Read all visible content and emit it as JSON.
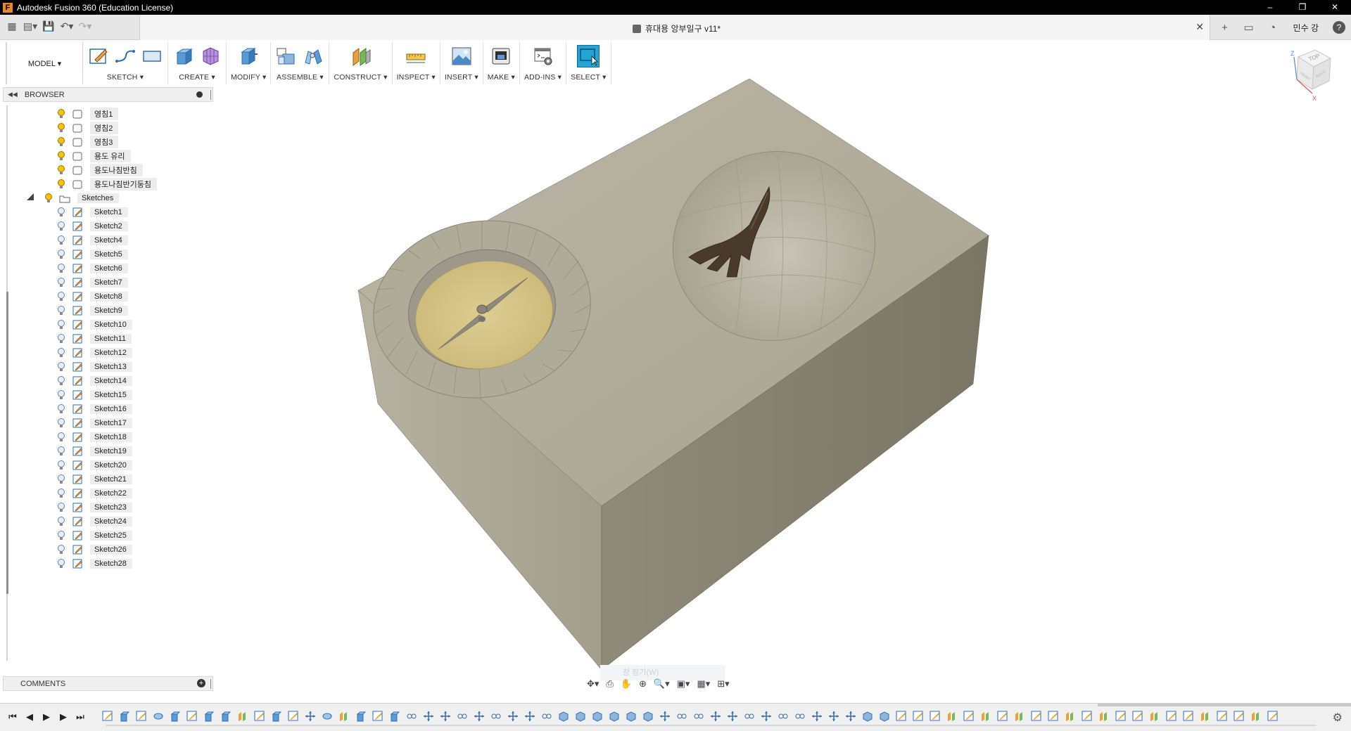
{
  "window": {
    "app_title": "Autodesk Fusion 360 (Education License)",
    "min": "–",
    "restore": "❐",
    "close": "✕"
  },
  "tabbar": {
    "doc_title": "휴대용 앙부일구 v11*",
    "close": "✕",
    "user": "민수 강",
    "help": "?"
  },
  "ribbon": {
    "workspace": "MODEL ▾",
    "groups": [
      {
        "label": "SKETCH ▾"
      },
      {
        "label": "CREATE ▾"
      },
      {
        "label": "MODIFY ▾"
      },
      {
        "label": "ASSEMBLE ▾"
      },
      {
        "label": "CONSTRUCT ▾"
      },
      {
        "label": "INSPECT ▾"
      },
      {
        "label": "INSERT ▾"
      },
      {
        "label": "MAKE ▾"
      },
      {
        "label": "ADD-INS ▾"
      },
      {
        "label": "SELECT ▾"
      }
    ]
  },
  "browser": {
    "title": "BROWSER",
    "bodies": [
      {
        "label": "영침1"
      },
      {
        "label": "영침2"
      },
      {
        "label": "영침3"
      },
      {
        "label": "용도 유리"
      },
      {
        "label": "용도나침반침"
      },
      {
        "label": "용도나침반기둥침"
      }
    ],
    "sketches_folder": "Sketches",
    "sketches": [
      {
        "label": "Sketch1"
      },
      {
        "label": "Sketch2"
      },
      {
        "label": "Sketch4"
      },
      {
        "label": "Sketch5"
      },
      {
        "label": "Sketch6"
      },
      {
        "label": "Sketch7"
      },
      {
        "label": "Sketch8"
      },
      {
        "label": "Sketch9"
      },
      {
        "label": "Sketch10"
      },
      {
        "label": "Sketch11"
      },
      {
        "label": "Sketch12"
      },
      {
        "label": "Sketch13"
      },
      {
        "label": "Sketch14"
      },
      {
        "label": "Sketch15"
      },
      {
        "label": "Sketch16"
      },
      {
        "label": "Sketch17"
      },
      {
        "label": "Sketch18"
      },
      {
        "label": "Sketch19"
      },
      {
        "label": "Sketch20"
      },
      {
        "label": "Sketch21"
      },
      {
        "label": "Sketch22"
      },
      {
        "label": "Sketch23"
      },
      {
        "label": "Sketch24"
      },
      {
        "label": "Sketch25"
      },
      {
        "label": "Sketch26"
      },
      {
        "label": "Sketch28"
      }
    ]
  },
  "comments": {
    "title": "COMMENTS",
    "add": "+"
  },
  "viewcube": {
    "top": "TOP",
    "front": "FRONT",
    "right": "RIGHT",
    "axis_z": "Z",
    "axis_x": "X"
  },
  "canvas": {
    "ghost_tip": "창 참기(W)"
  },
  "colors": {
    "select_accent": "#1ea7d6",
    "body_top": "#b8b2a2",
    "compass_face": "#d6c688",
    "gnomon": "#4a3a2c"
  }
}
